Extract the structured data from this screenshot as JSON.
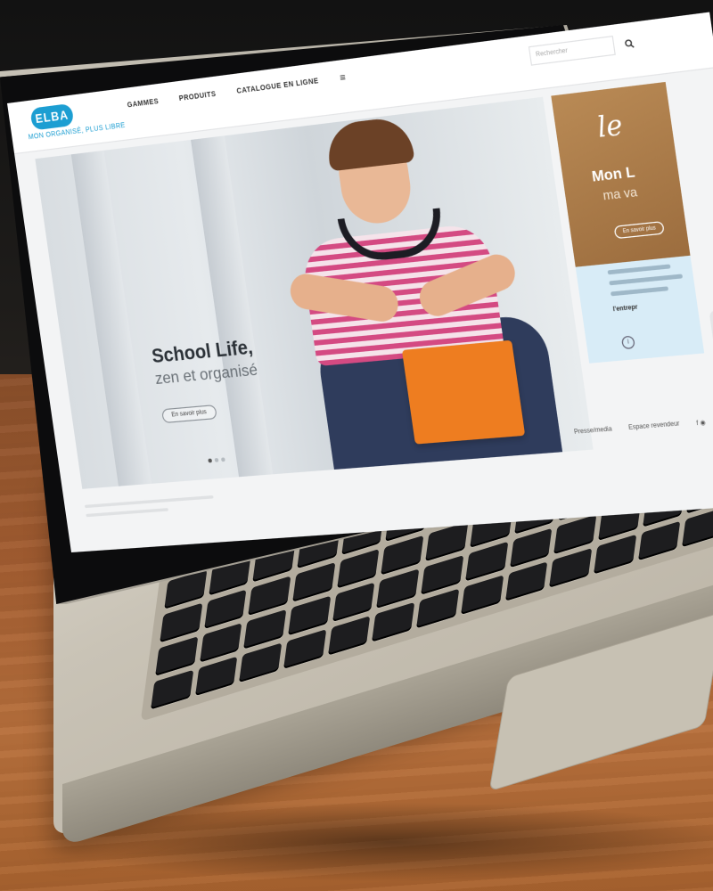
{
  "site": {
    "tagline": "MON ORGANISÉ, PLUS LIBRE"
  },
  "brand": {
    "logo_text": "ELBA",
    "accent_color": "#1c9ed2"
  },
  "nav": {
    "items": [
      "GAMMES",
      "PRODUITS",
      "CATALOGUE EN LIGNE"
    ],
    "menu_icon": "≡"
  },
  "search": {
    "placeholder": "Rechercher",
    "icon": "search-icon"
  },
  "hero": {
    "title": "School Life,",
    "subtitle": "zen et organisé",
    "button_label": "En savoir plus",
    "folder_color": "#ee7d20",
    "slide_count": 3,
    "active_slide": 1
  },
  "promo": {
    "script": "le",
    "title": "Mon L",
    "subtitle": "ma va",
    "button_label": "En savoir plus"
  },
  "promo2": {
    "emphasis": "l'entrepr"
  },
  "footer": {
    "links": [
      "Presse/media",
      "Espace revendeur"
    ],
    "social": "f  ◉"
  }
}
